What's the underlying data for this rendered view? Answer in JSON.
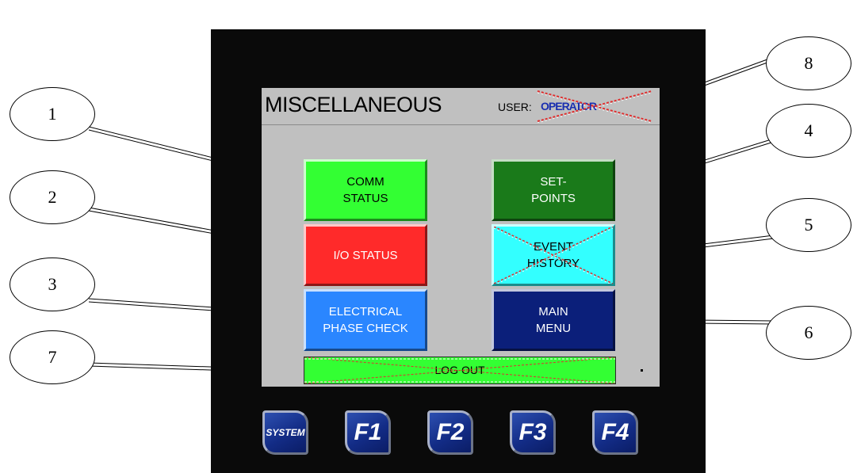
{
  "screen": {
    "title": "MISCELLANEOUS",
    "user_label": "USER:",
    "user_value": "OPERATOR"
  },
  "buttons": {
    "comm_status": {
      "line1": "COMM",
      "line2": "STATUS",
      "color": "#33ff33",
      "text_color": "#000000"
    },
    "io_status": {
      "line1": "I/O STATUS",
      "color": "#ff2a2a",
      "text_color": "#ffffff"
    },
    "electrical_phase_check": {
      "line1": "ELECTRICAL",
      "line2": "PHASE CHECK",
      "color": "#2a86ff",
      "text_color": "#ffffff"
    },
    "set_points": {
      "line1": "SET-",
      "line2": "POINTS",
      "color": "#1a7a1a",
      "text_color": "#ffffff"
    },
    "event_history": {
      "line1": "EVENT",
      "line2": "HISTORY",
      "color": "#33ffff",
      "text_color": "#000000"
    },
    "main_menu": {
      "line1": "MAIN",
      "line2": "MENU",
      "color": "#0b1f7a",
      "text_color": "#ffffff"
    },
    "log_out": {
      "label": "LOG OUT",
      "color": "#33ff33",
      "text_color": "#000000"
    }
  },
  "function_keys": [
    "SYSTEM",
    "F1",
    "F2",
    "F3",
    "F4"
  ],
  "callouts": [
    "1",
    "2",
    "3",
    "4",
    "5",
    "6",
    "7",
    "8"
  ]
}
